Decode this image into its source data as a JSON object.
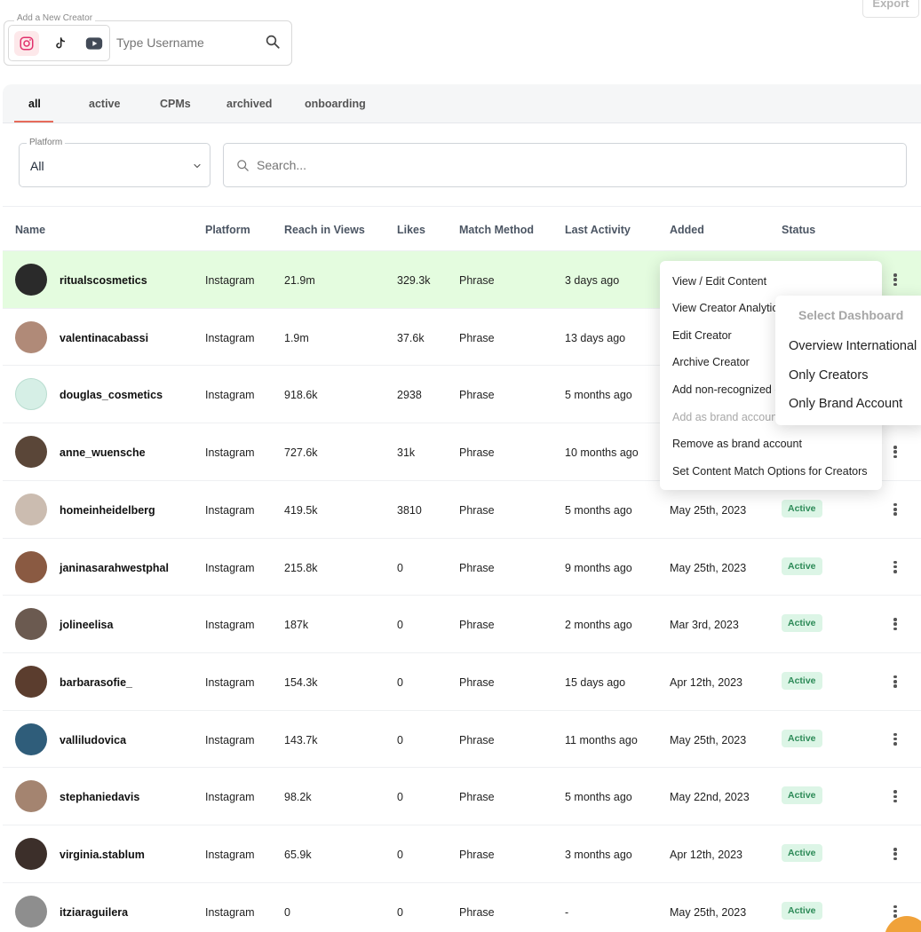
{
  "add_creator": {
    "legend": "Add a New Creator",
    "placeholder": "Type Username",
    "platforms": [
      "instagram-icon",
      "tiktok-icon",
      "youtube-icon"
    ]
  },
  "export_label": "Export",
  "tabs": [
    {
      "label": "all",
      "active": true
    },
    {
      "label": "active",
      "active": false
    },
    {
      "label": "CPMs",
      "active": false
    },
    {
      "label": "archived",
      "active": false
    },
    {
      "label": "onboarding",
      "active": false
    }
  ],
  "filter": {
    "legend": "Platform",
    "value": "All"
  },
  "search": {
    "placeholder": "Search..."
  },
  "columns": [
    "Name",
    "Platform",
    "Reach in Views",
    "Likes",
    "Match Method",
    "Last Activity",
    "Added",
    "Status"
  ],
  "rows": [
    {
      "name": "ritualscosmetics",
      "platform": "Instagram",
      "reach": "21.9m",
      "likes": "329.3k",
      "method": "Phrase",
      "last": "3 days ago",
      "added": "",
      "status": ""
    },
    {
      "name": "valentinacabassi",
      "platform": "Instagram",
      "reach": "1.9m",
      "likes": "37.6k",
      "method": "Phrase",
      "last": "13 days ago",
      "added": "",
      "status": ""
    },
    {
      "name": "douglas_cosmetics",
      "platform": "Instagram",
      "reach": "918.6k",
      "likes": "2938",
      "method": "Phrase",
      "last": "5 months ago",
      "added": "",
      "status": ""
    },
    {
      "name": "anne_wuensche",
      "platform": "Instagram",
      "reach": "727.6k",
      "likes": "31k",
      "method": "Phrase",
      "last": "10 months ago",
      "added": "",
      "status": ""
    },
    {
      "name": "homeinheidelberg",
      "platform": "Instagram",
      "reach": "419.5k",
      "likes": "3810",
      "method": "Phrase",
      "last": "5 months ago",
      "added": "May 25th, 2023",
      "status": "Active"
    },
    {
      "name": "janinasarahwestphal",
      "platform": "Instagram",
      "reach": "215.8k",
      "likes": "0",
      "method": "Phrase",
      "last": "9 months ago",
      "added": "May 25th, 2023",
      "status": "Active"
    },
    {
      "name": "jolineelisa",
      "platform": "Instagram",
      "reach": "187k",
      "likes": "0",
      "method": "Phrase",
      "last": "2 months ago",
      "added": "Mar 3rd, 2023",
      "status": "Active"
    },
    {
      "name": "barbarasofie_",
      "platform": "Instagram",
      "reach": "154.3k",
      "likes": "0",
      "method": "Phrase",
      "last": "15 days ago",
      "added": "Apr 12th, 2023",
      "status": "Active"
    },
    {
      "name": "valliludovica",
      "platform": "Instagram",
      "reach": "143.7k",
      "likes": "0",
      "method": "Phrase",
      "last": "11 months ago",
      "added": "May 25th, 2023",
      "status": "Active"
    },
    {
      "name": "stephaniedavis",
      "platform": "Instagram",
      "reach": "98.2k",
      "likes": "0",
      "method": "Phrase",
      "last": "5 months ago",
      "added": "May 22nd, 2023",
      "status": "Active"
    },
    {
      "name": "virginia.stablum",
      "platform": "Instagram",
      "reach": "65.9k",
      "likes": "0",
      "method": "Phrase",
      "last": "3 months ago",
      "added": "Apr 12th, 2023",
      "status": "Active"
    },
    {
      "name": "itziaraguilera",
      "platform": "Instagram",
      "reach": "0",
      "likes": "0",
      "method": "Phrase",
      "last": "-",
      "added": "May 25th, 2023",
      "status": "Active"
    }
  ],
  "menu": [
    {
      "label": "View / Edit Content",
      "disabled": false
    },
    {
      "label": "View Creator Analytics",
      "disabled": false
    },
    {
      "label": "Edit Creator",
      "disabled": false
    },
    {
      "label": "Archive Creator",
      "disabled": false
    },
    {
      "label": "Add non-recognized content",
      "disabled": false
    },
    {
      "label": "Add as brand account",
      "disabled": true
    },
    {
      "label": "Remove as brand account",
      "disabled": false
    },
    {
      "label": "Set Content Match Options for Creators",
      "disabled": false
    }
  ],
  "submenu": {
    "title": "Select Dashboard",
    "items": [
      "Overview International",
      "Only Creators",
      "Only Brand Account"
    ]
  },
  "colors": {
    "accent": "#e76b5a",
    "highlight_row": "#e4fcdf",
    "badge_bg": "#dcf5e6",
    "badge_text": "#2c8a57"
  }
}
